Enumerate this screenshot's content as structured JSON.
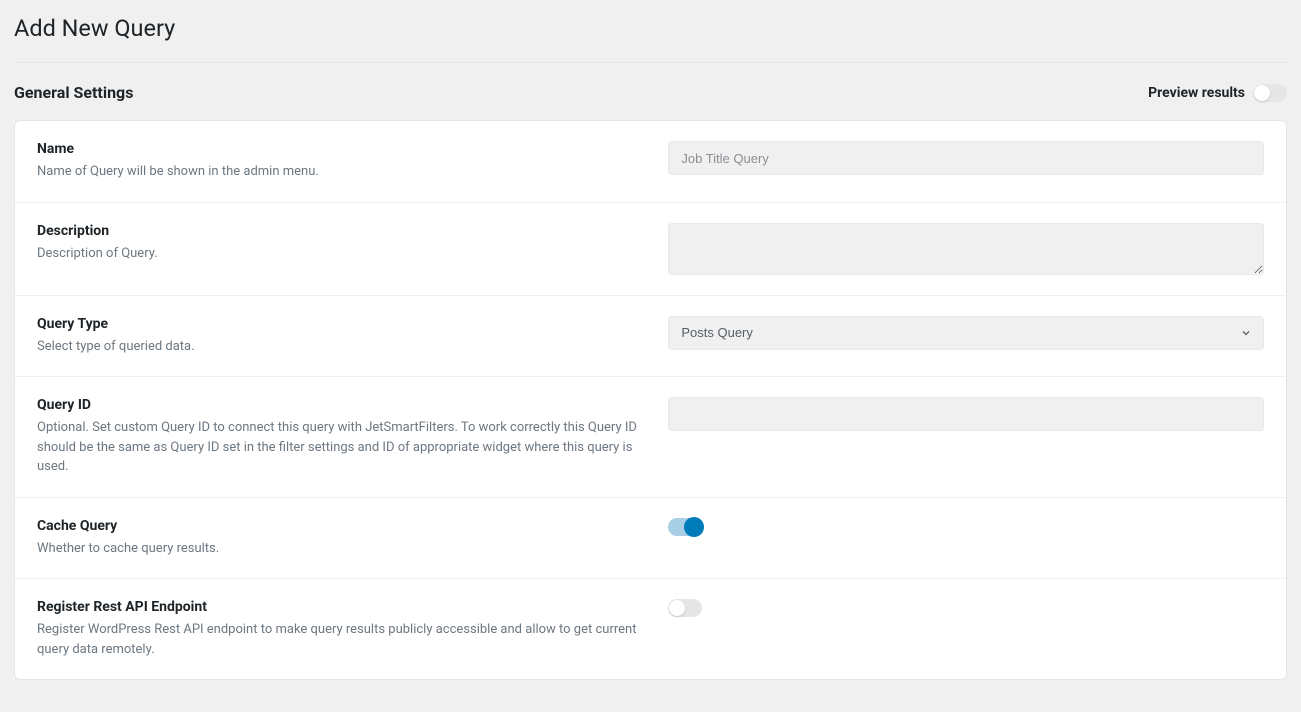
{
  "page": {
    "title": "Add New Query"
  },
  "section": {
    "title": "General Settings",
    "preview_label": "Preview results"
  },
  "fields": {
    "name": {
      "label": "Name",
      "desc": "Name of Query will be shown in the admin menu.",
      "placeholder": "Job Title Query",
      "value": ""
    },
    "description": {
      "label": "Description",
      "desc": "Description of Query.",
      "value": ""
    },
    "query_type": {
      "label": "Query Type",
      "desc": "Select type of queried data.",
      "selected": "Posts Query"
    },
    "query_id": {
      "label": "Query ID",
      "desc": "Optional. Set custom Query ID to connect this query with JetSmartFilters. To work correctly this Query ID should be the same as Query ID set in the filter settings and ID of appropriate widget where this query is used.",
      "value": ""
    },
    "cache_query": {
      "label": "Cache Query",
      "desc": "Whether to cache query results.",
      "state": true
    },
    "rest_api": {
      "label": "Register Rest API Endpoint",
      "desc": "Register WordPress Rest API endpoint to make query results publicly accessible and allow to get current query data remotely.",
      "state": false
    }
  }
}
